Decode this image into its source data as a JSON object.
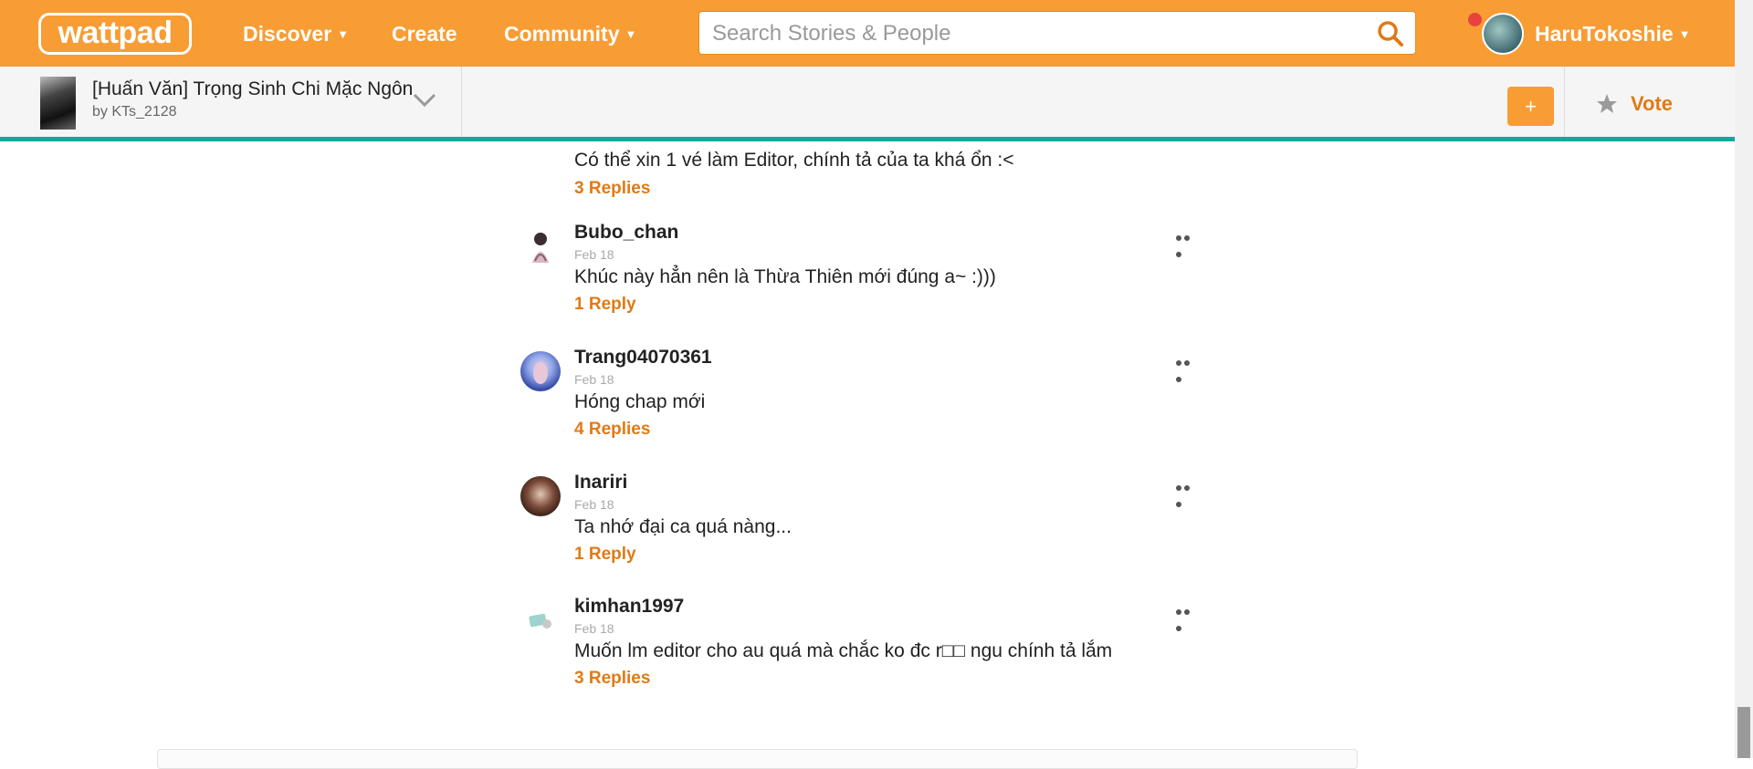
{
  "header": {
    "logo_text": "wattpad",
    "nav": [
      {
        "label": "Discover",
        "has_caret": true
      },
      {
        "label": "Create",
        "has_caret": false
      },
      {
        "label": "Community",
        "has_caret": true
      }
    ],
    "search_placeholder": "Search Stories & People",
    "username": "HaruTokoshie",
    "accent_color": "#f89c34"
  },
  "story": {
    "title": "[Huấn Văn] Trọng Sinh Chi Mặc Ngôn",
    "author": "by KTs_2128",
    "add_label": "+",
    "vote_label": "Vote",
    "divider_color": "#14a79a"
  },
  "partial_comment": {
    "text": "Có thể xin 1 vé làm Editor, chính tả của ta khá ổn :<",
    "replies": "3 Replies"
  },
  "comments": [
    {
      "author": "Bubo_chan",
      "date": "Feb 18",
      "text": "Khúc này hẳn nên là Thừa Thiên mới đúng a~ :)))",
      "replies": "1 Reply"
    },
    {
      "author": "Trang04070361",
      "date": "Feb 18",
      "text": "Hóng chap mới",
      "replies": "4 Replies"
    },
    {
      "author": "Inariri",
      "date": "Feb 18",
      "text": "Ta nhớ đại ca quá nàng...",
      "replies": "1 Reply"
    },
    {
      "author": "kimhan1997",
      "date": "Feb 18",
      "text": "Muốn lm editor cho au quá mà chắc ko đc r□□ ngu chính tả lắm",
      "replies": "3 Replies"
    }
  ]
}
